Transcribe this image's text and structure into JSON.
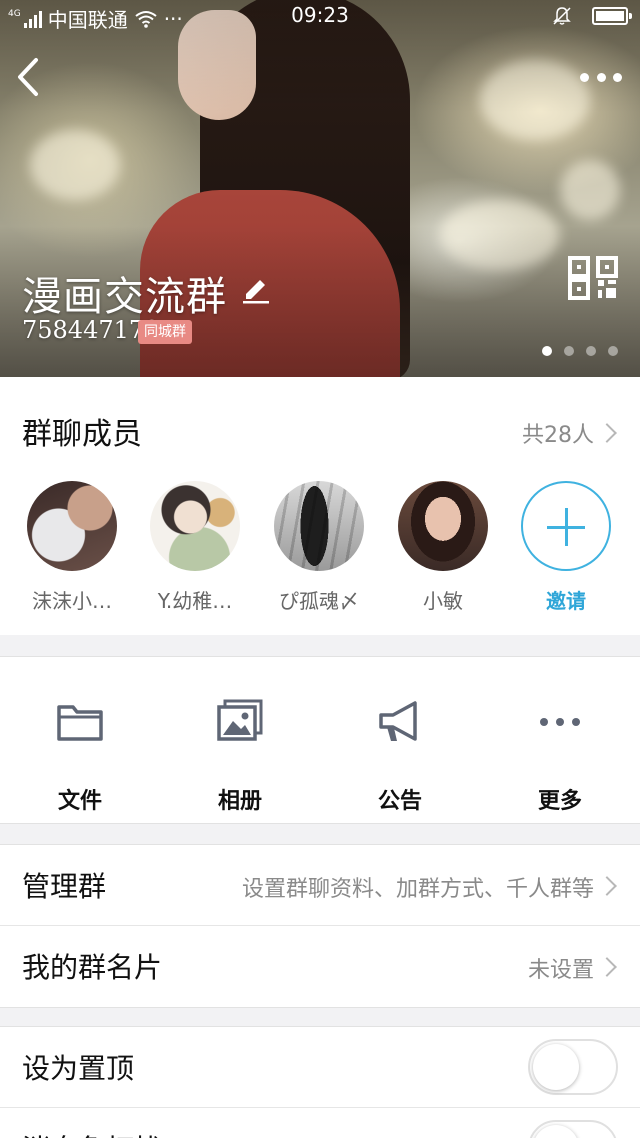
{
  "status_bar": {
    "network_type": "4G",
    "carrier": "中国联通",
    "extra": "···",
    "time": "09:23"
  },
  "header": {
    "title": "漫画交流群",
    "group_id": "758447178",
    "badge": "同城群",
    "page_count": 4,
    "active_page": 1
  },
  "members": {
    "title": "群聊成员",
    "count": "共28人",
    "items": [
      {
        "name": "沫沫小…"
      },
      {
        "name": "Y.幼稚…"
      },
      {
        "name": "ぴ孤魂〆"
      },
      {
        "name": "小敏"
      }
    ],
    "invite_label": "邀请"
  },
  "actions": [
    {
      "label": "文件",
      "icon": "folder-icon"
    },
    {
      "label": "相册",
      "icon": "album-icon"
    },
    {
      "label": "公告",
      "icon": "megaphone-icon"
    },
    {
      "label": "更多",
      "icon": "more-dots-icon"
    }
  ],
  "settings": {
    "manage": {
      "label": "管理群",
      "value": "设置群聊资料、加群方式、千人群等"
    },
    "my_card": {
      "label": "我的群名片",
      "value": "未设置"
    },
    "pin": {
      "label": "设为置顶",
      "enabled": false
    },
    "dnd": {
      "label": "消息免打扰",
      "enabled": false
    }
  },
  "colors": {
    "accent": "#2fa6d8",
    "badge": "#e88a84",
    "icon_gray": "#5f6675"
  }
}
